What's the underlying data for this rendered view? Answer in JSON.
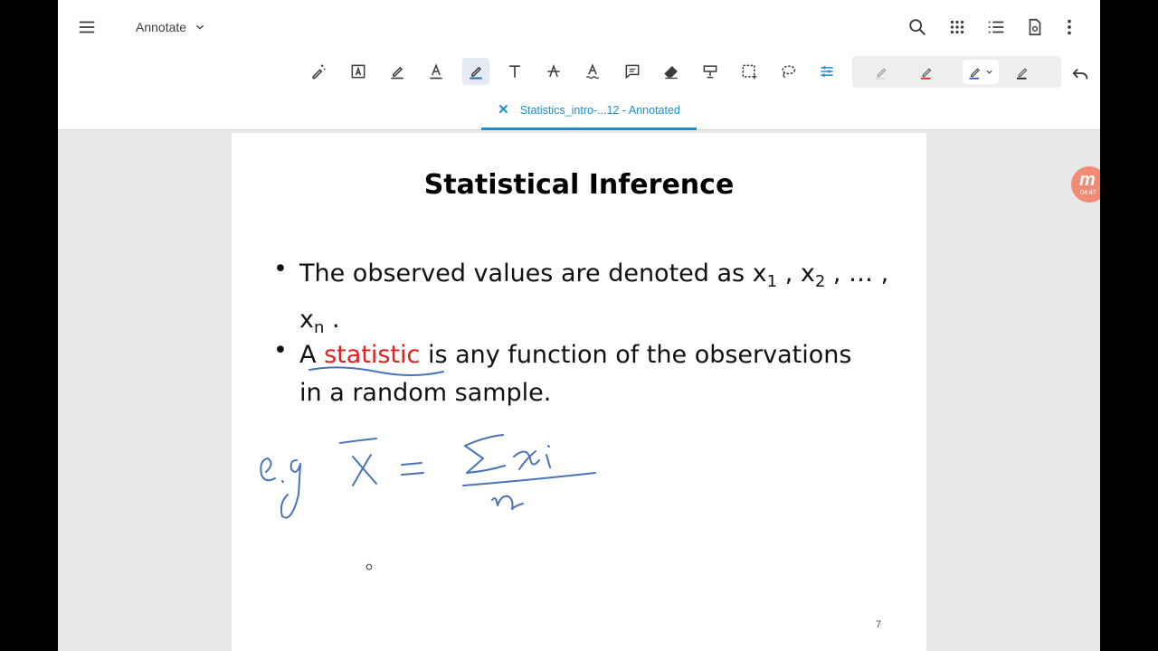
{
  "topbar": {
    "mode_label": "Annotate",
    "icons": [
      "menu-icon",
      "chevron-down-icon",
      "search-icon",
      "apps-grid-icon",
      "list-icon",
      "document-settings-icon",
      "more-vert-icon"
    ]
  },
  "toolbar": {
    "tools": [
      "magic-pen-icon",
      "text-box-icon",
      "highlighter-icon",
      "text-underline-icon",
      "pen-icon",
      "text-icon",
      "strikethrough-icon",
      "squiggly-text-icon",
      "comment-icon",
      "eraser-icon",
      "stamp-icon",
      "selection-icon",
      "lasso-icon",
      "adjust-icon"
    ],
    "active_tool": "pen-icon",
    "pen_colors": [
      "#d8d8d8",
      "#e02020",
      "#2b5fc5",
      "#222222"
    ],
    "selected_pen_color": "#2b5fc5",
    "accent_color": "#1a8fd6",
    "undo_icon": "undo-icon"
  },
  "tab": {
    "label": "Statistics_intro-...12 - Annotated",
    "close_glyph": "✕"
  },
  "page": {
    "title": "Statistical Inference",
    "bullet_1": {
      "text_before": "The observed values are denoted as x",
      "sub_1": "1",
      "sep_1": " , x",
      "sub_2": "2",
      "text_after": " , … ,",
      "line2_x": "x",
      "sub_n": "n",
      "line2_end": " ."
    },
    "bullet_2": {
      "text_a": "A ",
      "highlight": "statistic",
      "text_b": " is any function of the observations",
      "line2": "in a random sample."
    },
    "page_number": "7",
    "ink_color": "#4a73b8",
    "highlight_color": "#e0201f"
  },
  "recorder": {
    "letter": "m",
    "time": "04:47"
  }
}
